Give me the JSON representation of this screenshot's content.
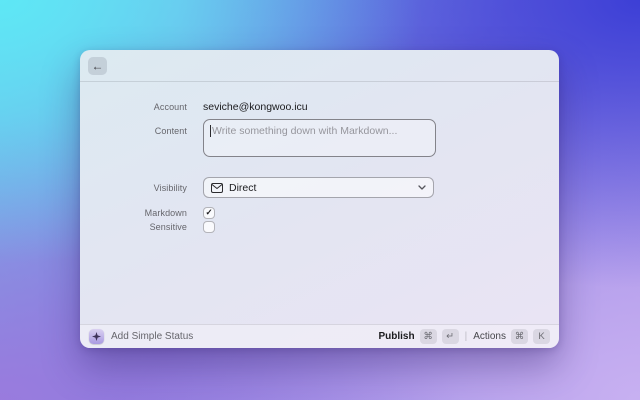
{
  "window": {
    "header": {
      "back_icon": "←"
    },
    "form": {
      "account_label": "Account",
      "account_value": "seviche@kongwoo.icu",
      "content_label": "Content",
      "content_placeholder": "Write something down with Markdown...",
      "visibility_label": "Visibility",
      "visibility_value": "Direct",
      "markdown_label": "Markdown",
      "markdown_check": "✓",
      "sensitive_label": "Sensitive",
      "sensitive_check": ""
    },
    "footer": {
      "status_text": "Add Simple Status",
      "publish_label": "Publish",
      "publish_keys": [
        "⌘",
        "↵"
      ],
      "divider": "|",
      "actions_label": "Actions",
      "actions_keys": [
        "⌘",
        "K"
      ]
    }
  },
  "colors": {
    "bg_top_left": "#5de9f6",
    "bg_top_right": "#3b3ed6",
    "bg_bottom_left": "#9b7add",
    "bg_bottom_right": "#c9b2f2",
    "window_bg_top": "#dceaf1",
    "window_bg_bottom": "#eae4f4"
  }
}
